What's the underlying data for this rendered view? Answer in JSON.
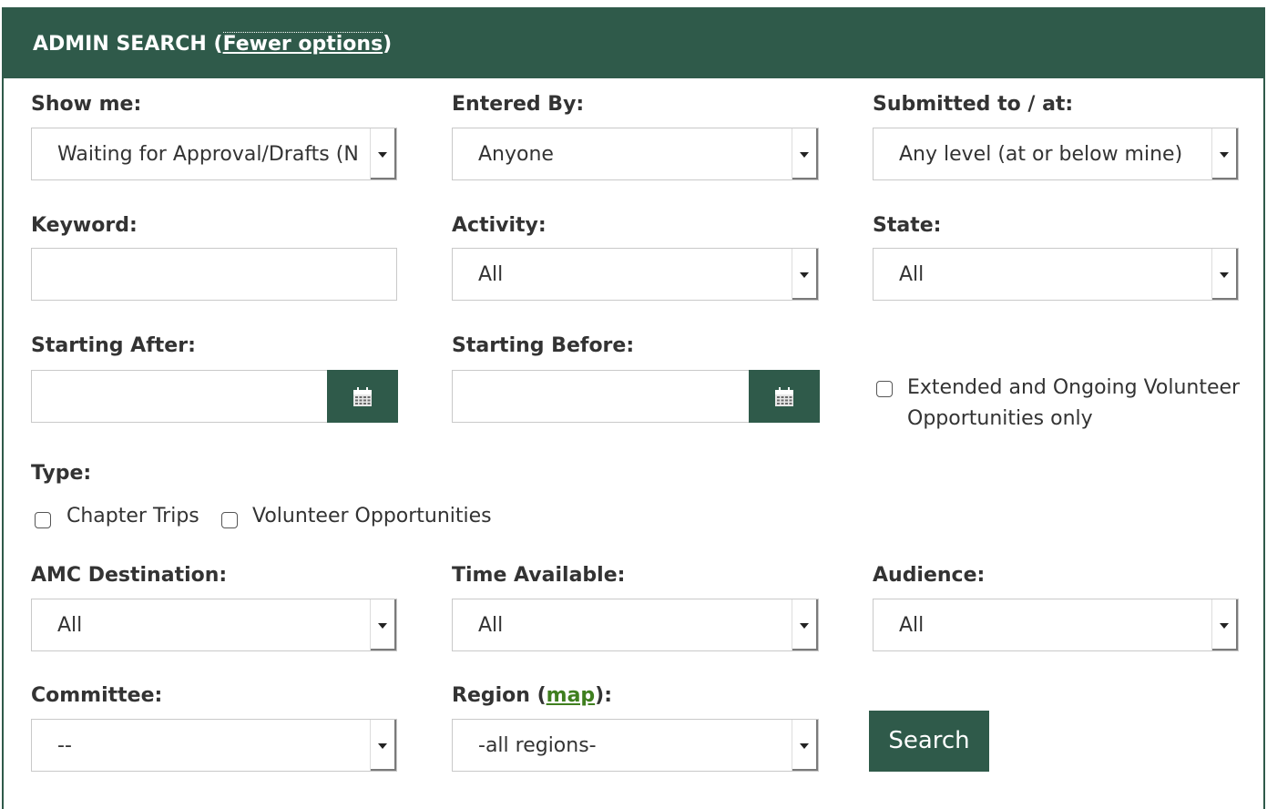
{
  "header": {
    "title": "ADMIN SEARCH",
    "open_paren": " (",
    "toggle_link": "Fewer options",
    "close_paren": ")"
  },
  "filters": {
    "show_me": {
      "label": "Show me:",
      "value": "Waiting for Approval/Drafts (No"
    },
    "entered_by": {
      "label": "Entered By:",
      "value": "Anyone"
    },
    "submitted_to": {
      "label": "Submitted to / at:",
      "value": "Any level (at or below mine)"
    },
    "keyword": {
      "label": "Keyword:",
      "value": ""
    },
    "activity": {
      "label": "Activity:",
      "value": "All"
    },
    "state": {
      "label": "State:",
      "value": "All"
    },
    "starting_after": {
      "label": "Starting After:",
      "value": ""
    },
    "starting_before": {
      "label": "Starting Before:",
      "value": ""
    },
    "extended_only": {
      "label_line1": "Extended and Ongoing Volunteer",
      "label_line2": "Opportunities only",
      "checked": false
    },
    "type": {
      "label": "Type:",
      "options": [
        {
          "label": "Chapter Trips",
          "checked": false
        },
        {
          "label": "Volunteer Opportunities",
          "checked": false
        }
      ]
    },
    "amc_destination": {
      "label": "AMC Destination:",
      "value": "All"
    },
    "time_available": {
      "label": "Time Available:",
      "value": "All"
    },
    "audience": {
      "label": "Audience:",
      "value": "All"
    },
    "committee": {
      "label": "Committee:",
      "value": "--"
    },
    "region": {
      "label_prefix": "Region (",
      "map_link": "map",
      "label_suffix": "):",
      "value": "-all regions-"
    }
  },
  "search_button": {
    "label": "Search"
  },
  "icons": {
    "calendar": "calendar-icon",
    "dropdown": "chevron-down-icon"
  },
  "colors": {
    "header_bg": "#2f5a4a",
    "link_green": "#3f7f1f"
  }
}
